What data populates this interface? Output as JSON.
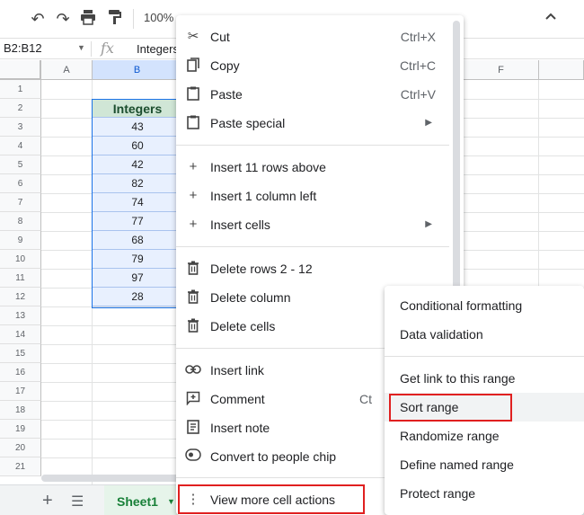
{
  "toolbar": {
    "undo_icon": "undo-icon",
    "redo_icon": "redo-icon",
    "print_icon": "print-icon",
    "paint_format_icon": "paint-format-icon",
    "zoom": "100%",
    "collapse_icon": "chevron-up-icon"
  },
  "formula_bar": {
    "name_box": "B2:B12",
    "fx": "fx",
    "value": "Integers"
  },
  "columns": [
    "A",
    "B",
    "F"
  ],
  "rows": [
    "1",
    "2",
    "3",
    "4",
    "5",
    "6",
    "7",
    "8",
    "9",
    "10",
    "11",
    "12",
    "13",
    "14",
    "15",
    "16",
    "17",
    "18",
    "19",
    "20",
    "21"
  ],
  "table": {
    "header": "Integers",
    "values": [
      "43",
      "60",
      "42",
      "82",
      "74",
      "77",
      "68",
      "79",
      "97",
      "28"
    ]
  },
  "sheet_tabs": {
    "add_icon": "plus-icon",
    "list_icon": "menu-icon",
    "active_tab": "Sheet1"
  },
  "context_menu": {
    "cut": {
      "label": "Cut",
      "shortcut": "Ctrl+X"
    },
    "copy": {
      "label": "Copy",
      "shortcut": "Ctrl+C"
    },
    "paste": {
      "label": "Paste",
      "shortcut": "Ctrl+V"
    },
    "paste_special": {
      "label": "Paste special"
    },
    "insert_rows": {
      "label": "Insert 11 rows above"
    },
    "insert_column": {
      "label": "Insert 1 column left"
    },
    "insert_cells": {
      "label": "Insert cells"
    },
    "delete_rows": {
      "label": "Delete rows 2 - 12"
    },
    "delete_column": {
      "label": "Delete column"
    },
    "delete_cells": {
      "label": "Delete cells"
    },
    "insert_link": {
      "label": "Insert link"
    },
    "comment": {
      "label": "Comment",
      "shortcut": "Ct"
    },
    "insert_note": {
      "label": "Insert note"
    },
    "convert_chip": {
      "label": "Convert to people chip"
    },
    "view_more": {
      "label": "View more cell actions"
    }
  },
  "submenu": {
    "conditional_formatting": "Conditional formatting",
    "data_validation": "Data validation",
    "get_link": "Get link to this range",
    "sort_range": "Sort range",
    "randomize_range": "Randomize range",
    "define_named_range": "Define named range",
    "protect_range": "Protect range"
  },
  "colors": {
    "highlight": "#e02020",
    "header_fill": "#d0e6d6",
    "selection_fill": "#e8f0fe",
    "sheet_tab": "#188038"
  }
}
